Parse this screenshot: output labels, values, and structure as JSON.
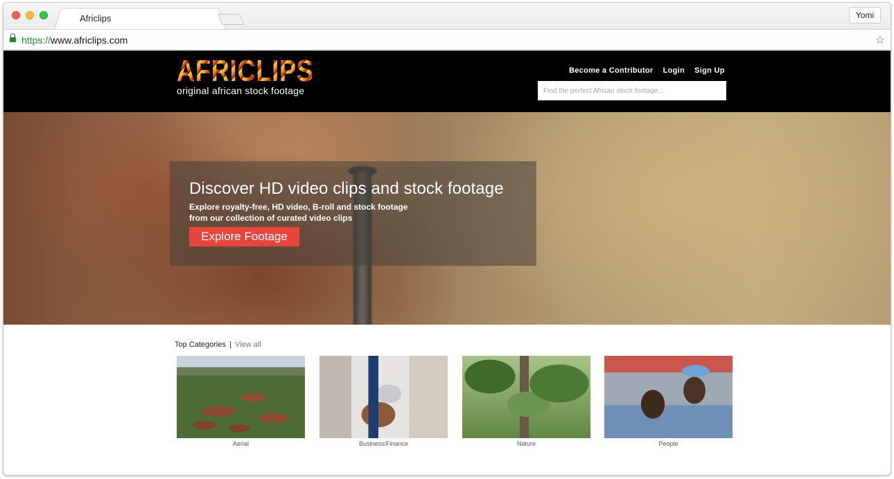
{
  "browser": {
    "tab_title": "Africlips",
    "profile_name": "Yomi",
    "url_scheme": "https://",
    "url_rest": "www.africlips.com",
    "icons": [
      "lock-icon",
      "star-icon"
    ]
  },
  "header": {
    "logo_word": "AFRICLIPS",
    "logo_tagline": "original african stock footage",
    "nav": [
      "Become a Contributor",
      "Login",
      "Sign Up"
    ],
    "search_placeholder": "Find the perfect African stock footage..."
  },
  "hero": {
    "title": "Discover HD video clips and stock footage",
    "subtitle_line1": "Explore royalty-free, HD video, B-roll and stock footage",
    "subtitle_line2": "from our collection of curated video clips",
    "button_label": "Explore Footage",
    "button_color": "#e8463c"
  },
  "categories": {
    "heading": "Top Categories",
    "separator": "|",
    "view_all": "View all",
    "items": [
      {
        "label": "Aerial"
      },
      {
        "label": "Business/Finance"
      },
      {
        "label": "Nature"
      },
      {
        "label": "People"
      }
    ]
  },
  "colors": {
    "header_bg": "#000000",
    "accent": "#e8463c",
    "url_secure": "#1b8a2f"
  }
}
